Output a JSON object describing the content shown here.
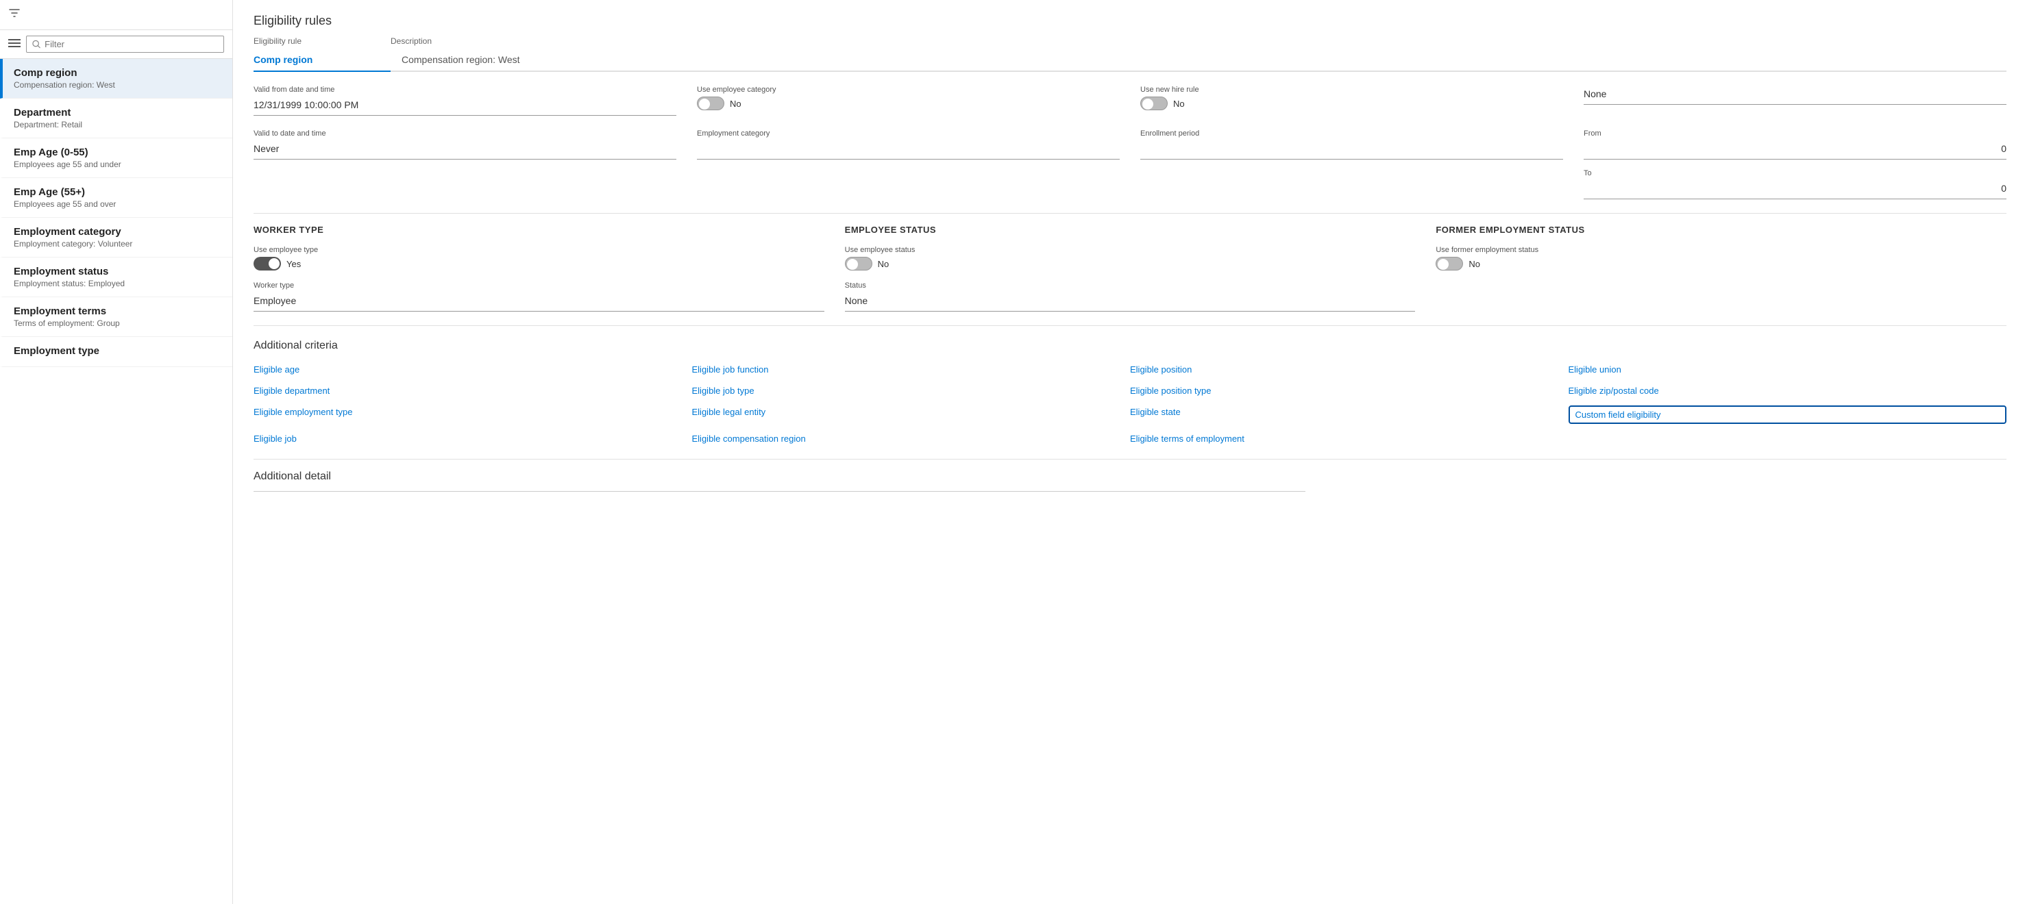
{
  "sidebar": {
    "filter_placeholder": "Filter",
    "items": [
      {
        "id": "comp-region",
        "title": "Comp region",
        "subtitle": "Compensation region:  West",
        "active": true
      },
      {
        "id": "department",
        "title": "Department",
        "subtitle": "Department:  Retail",
        "active": false
      },
      {
        "id": "emp-age-0-55",
        "title": "Emp Age (0-55)",
        "subtitle": "Employees age 55 and under",
        "active": false
      },
      {
        "id": "emp-age-55-plus",
        "title": "Emp Age (55+)",
        "subtitle": "Employees age 55 and over",
        "active": false
      },
      {
        "id": "employment-category",
        "title": "Employment category",
        "subtitle": "Employment category:  Volunteer",
        "active": false
      },
      {
        "id": "employment-status",
        "title": "Employment status",
        "subtitle": "Employment status:  Employed",
        "active": false
      },
      {
        "id": "employment-terms",
        "title": "Employment terms",
        "subtitle": "Terms of employment:  Group",
        "active": false
      },
      {
        "id": "employment-type",
        "title": "Employment type",
        "subtitle": "",
        "active": false
      }
    ]
  },
  "page": {
    "title": "Eligibility rules",
    "tab_col1_label": "Eligibility rule",
    "tab_col2_label": "Description",
    "tab_active": "Comp region",
    "tab_description": "Compensation region:  West"
  },
  "form": {
    "valid_from_label": "Valid from date and time",
    "valid_from_value": "12/31/1999 10:00:00 PM",
    "valid_to_label": "Valid to date and time",
    "valid_to_value": "Never",
    "use_employee_category_label": "Use employee category",
    "use_employee_category_toggle": "off",
    "use_employee_category_text": "No",
    "employment_category_label": "Employment category",
    "employment_category_value": "",
    "use_new_hire_rule_label": "Use new hire rule",
    "use_new_hire_rule_toggle": "off",
    "use_new_hire_rule_text": "No",
    "none_label": "None",
    "from_label": "From",
    "from_value": "0",
    "to_label": "To",
    "to_value": "0",
    "enrollment_period_label": "Enrollment period",
    "worker_type_header": "WORKER TYPE",
    "use_employee_type_label": "Use employee type",
    "use_employee_type_toggle": "on",
    "use_employee_type_text": "Yes",
    "worker_type_label": "Worker type",
    "worker_type_value": "Employee",
    "employee_status_header": "EMPLOYEE STATUS",
    "use_employee_status_label": "Use employee status",
    "use_employee_status_toggle": "off",
    "use_employee_status_text": "No",
    "status_label": "Status",
    "status_value": "None",
    "former_employment_status_header": "FORMER EMPLOYMENT STATUS",
    "use_former_employment_status_label": "Use former employment status",
    "use_former_employment_status_toggle": "off",
    "use_former_employment_status_text": "No"
  },
  "additional_criteria": {
    "title": "Additional criteria",
    "links": [
      [
        "Eligible age",
        "Eligible job function",
        "Eligible position",
        "Eligible union"
      ],
      [
        "Eligible department",
        "Eligible job type",
        "Eligible position type",
        "Eligible zip/postal code"
      ],
      [
        "Eligible employment type",
        "Eligible legal entity",
        "Eligible state",
        "Custom field eligibility"
      ],
      [
        "Eligible job",
        "Eligible compensation region",
        "Eligible terms of employment",
        ""
      ]
    ]
  },
  "additional_detail": {
    "title": "Additional detail"
  }
}
